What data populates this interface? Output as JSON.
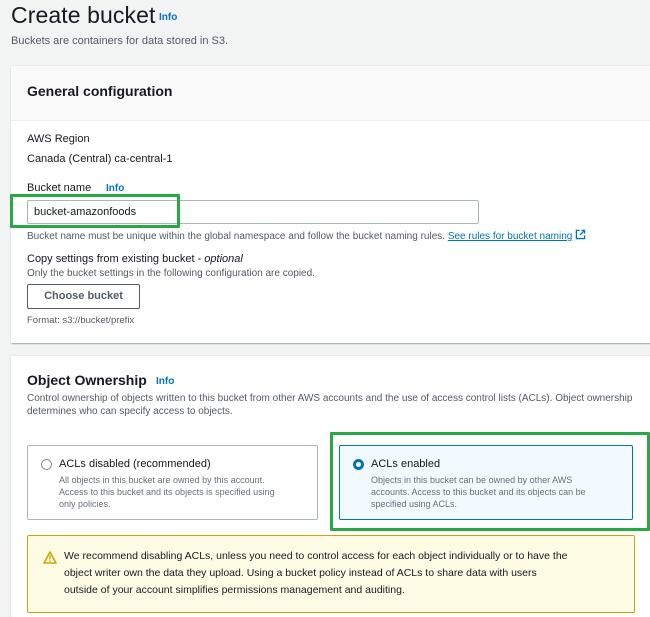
{
  "page": {
    "title": "Create bucket",
    "title_info": "Info",
    "description": "Buckets are containers for data stored in S3."
  },
  "general": {
    "heading": "General configuration",
    "region_label": "AWS Region",
    "region_value": "Canada (Central) ca-central-1",
    "bucket_name_label": "Bucket name",
    "bucket_name_info": "Info",
    "bucket_name_value": "bucket-amazonfoods",
    "bucket_name_hint": "Bucket name must be unique within the global namespace and follow the bucket naming rules.",
    "naming_rules_link": "See rules for bucket naming",
    "copy_settings_label": "Copy settings from existing bucket - ",
    "copy_settings_optional": "optional",
    "copy_settings_hint": "Only the bucket settings in the following configuration are copied.",
    "choose_bucket_button": "Choose bucket",
    "format_hint": "Format: s3://bucket/prefix"
  },
  "ownership": {
    "heading": "Object Ownership",
    "info": "Info",
    "description_line1": "Control ownership of objects written to this bucket from other AWS accounts and the use of access control lists (ACLs). Object ownership",
    "description_line2": "determines who can specify access to objects.",
    "options": [
      {
        "title": "ACLs disabled (recommended)",
        "desc1": "All objects in this bucket are owned by this account.",
        "desc2": "Access to this bucket and its objects is specified using",
        "desc3": "only policies.",
        "selected": false
      },
      {
        "title": "ACLs enabled",
        "desc1": "Objects in this bucket can be owned by other AWS",
        "desc2": "accounts. Access to this bucket and its objects can be",
        "desc3": "specified using ACLs.",
        "selected": true
      }
    ],
    "warning_line1": "We recommend disabling ACLs, unless you need to control access for each object individually or to have the",
    "warning_line2": "object writer own the data they upload. Using a bucket policy instead of ACLs to share data with users",
    "warning_line3": "outside of your account simplifies permissions management and auditing."
  },
  "colors": {
    "link": "#0073bb",
    "highlight": "#28a745",
    "warning_icon": "#d1a300"
  },
  "icons": {
    "external_link": "external-link-icon",
    "warning": "warning-icon"
  }
}
